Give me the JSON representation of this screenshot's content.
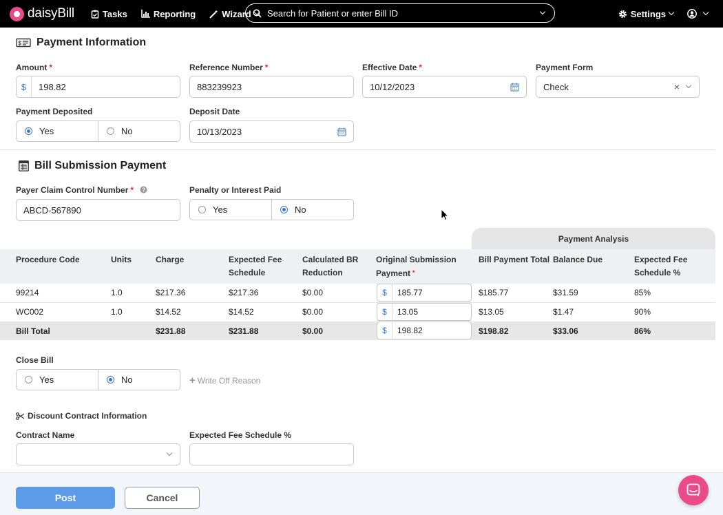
{
  "nav": {
    "logo": "daisyBill",
    "tasks": "Tasks",
    "reporting": "Reporting",
    "wizard": "Wizard",
    "search_placeholder": "Search for Patient or enter Bill ID",
    "settings": "Settings"
  },
  "payment_info": {
    "title": "Payment Information",
    "amount": {
      "label": "Amount",
      "prefix": "$",
      "value": "198.82"
    },
    "reference": {
      "label": "Reference Number",
      "value": "883239923"
    },
    "effective_date": {
      "label": "Effective Date",
      "value": "10/12/2023"
    },
    "payment_form": {
      "label": "Payment Form",
      "value": "Check",
      "clear": "×"
    },
    "deposited": {
      "label": "Payment Deposited",
      "yes": "Yes",
      "no": "No",
      "selected": "Yes"
    },
    "deposit_date": {
      "label": "Deposit Date",
      "value": "10/13/2023"
    },
    "required_mark": "*"
  },
  "bill_submission": {
    "title": "Bill Submission Payment",
    "claim_number": {
      "label": "Payer Claim Control Number",
      "value": "ABCD-567890"
    },
    "penalty": {
      "label": "Penalty or Interest Paid",
      "yes": "Yes",
      "no": "No",
      "selected": "No"
    }
  },
  "table": {
    "analysis_header": "Payment Analysis",
    "headers": {
      "procedure_code": "Procedure Code",
      "units": "Units",
      "charge": "Charge",
      "expected_fee_1": "Expected Fee",
      "expected_fee_2": "Schedule",
      "calc_br_1": "Calculated BR",
      "calc_br_2": "Reduction",
      "orig_sub_1": "Original Submission",
      "orig_sub_2": "Payment",
      "bill_payment_total": "Bill Payment Total",
      "balance_due": "Balance Due",
      "exp_fee_pct_1": "Expected Fee",
      "exp_fee_pct_2": "Schedule %"
    },
    "rows": [
      {
        "code": "99214",
        "units": "1.0",
        "charge": "$217.36",
        "expected": "$217.36",
        "br": "$0.00",
        "payment": "185.77",
        "bill_total": "$185.77",
        "balance": "$31.59",
        "pct": "85%"
      },
      {
        "code": "WC002",
        "units": "1.0",
        "charge": "$14.52",
        "expected": "$14.52",
        "br": "$0.00",
        "payment": "13.05",
        "bill_total": "$13.05",
        "balance": "$1.47",
        "pct": "90%"
      }
    ],
    "total": {
      "label": "Bill Total",
      "charge": "$231.88",
      "expected": "$231.88",
      "br": "$0.00",
      "payment": "198.82",
      "bill_total": "$198.82",
      "balance": "$33.06",
      "pct": "86%"
    },
    "currency_prefix": "$"
  },
  "close_bill": {
    "label": "Close Bill",
    "yes": "Yes",
    "no": "No",
    "selected": "No",
    "write_off": "Write Off Reason"
  },
  "discount": {
    "title": "Discount Contract Information",
    "contract_name": {
      "label": "Contract Name",
      "value": ""
    },
    "expected_fee_pct": {
      "label": "Expected Fee Schedule %",
      "value": ""
    }
  },
  "footer": {
    "post": "Post",
    "cancel": "Cancel"
  },
  "colors": {
    "accent": "#3a77c8",
    "post_button": "#5b9be8",
    "brand_pink": "#ea4c89"
  }
}
